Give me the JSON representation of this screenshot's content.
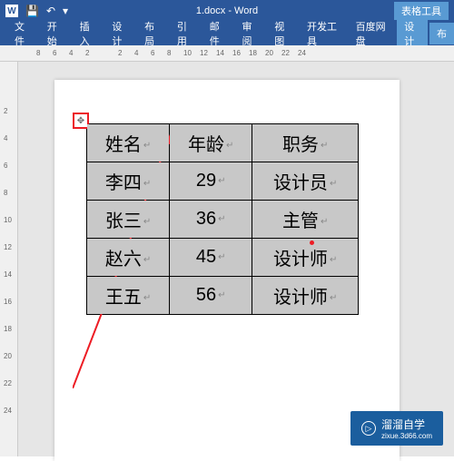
{
  "titlebar": {
    "title": "1.docx - Word",
    "table_tools_label": "表格工具",
    "save_icon_glyph": "💾",
    "undo_glyph": "↶",
    "dropdown_glyph": "▾"
  },
  "ribbon": {
    "tabs": [
      "文件",
      "开始",
      "插入",
      "设计",
      "布局",
      "引用",
      "邮件",
      "审阅",
      "视图",
      "开发工具",
      "百度网盘"
    ],
    "context_tabs": [
      "设计",
      "布"
    ]
  },
  "ruler_h": [
    "8",
    "6",
    "4",
    "2",
    "",
    "2",
    "4",
    "6",
    "8",
    "10",
    "12",
    "14",
    "16",
    "18",
    "20",
    "22",
    "24"
  ],
  "ruler_v": [
    "2",
    "4",
    "6",
    "8",
    "10",
    "12",
    "14",
    "16",
    "18",
    "20",
    "22",
    "24"
  ],
  "table": {
    "headers": [
      "姓名",
      "年龄",
      "职务"
    ],
    "rows": [
      [
        "李四",
        "29",
        "设计员"
      ],
      [
        "张三",
        "36",
        "主管"
      ],
      [
        "赵六",
        "45",
        "设计师"
      ],
      [
        "王五",
        "56",
        "设计师"
      ]
    ]
  },
  "table_handle_glyph": "✥",
  "watermark": {
    "text": "溜溜自学",
    "url": "zixue.3d66.com",
    "icon_glyph": "▷"
  }
}
